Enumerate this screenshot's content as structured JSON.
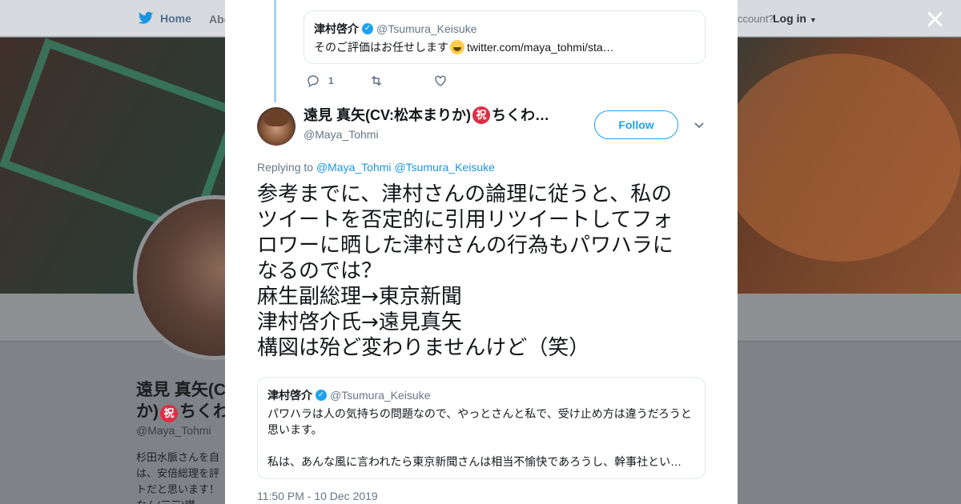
{
  "background": {
    "nav_home": "Home",
    "nav_about": "Abo",
    "account_prompt": "ccount?",
    "login": "Log in",
    "profile_name_line1": "遠見 真矢(C",
    "profile_name_line2": "か)",
    "profile_name_suffix": "ちくわ",
    "profile_name_badge": "祝",
    "profile_handle": "@Maya_Tohmi",
    "bio_lines": [
      "杉田水脈さんを自",
      "は、安倍総理を評",
      "トだと思います！",
      "なん(三三)讃"
    ]
  },
  "previous_tweet": {
    "quoted_name": "津村啓介",
    "quoted_handle": "@Tsumura_Keisuke",
    "quoted_text": "そのご評価はお任せします",
    "quoted_link": "twitter.com/maya_tohmi/sta…",
    "reply_count": "1"
  },
  "tweet": {
    "display_name": "遠見 真矢(CV:松本まりか)",
    "display_badge": "祝",
    "display_suffix": "ちくわ…",
    "handle": "@Maya_Tohmi",
    "follow_label": "Follow",
    "replying_prefix": "Replying to",
    "replying_to_1": "@Maya_Tohmi",
    "replying_to_2": "@Tsumura_Keisuke",
    "text_lines": [
      "参考までに、津村さんの論理に従うと、私の",
      "ツイートを否定的に引用リツイートしてフォ",
      "ロワーに晒した津村さんの行為もパワハラに",
      "なるのでは？",
      "麻生副総理→東京新聞",
      "津村啓介氏→遠見真矢",
      "構図は殆ど変わりませんけど（笑）"
    ],
    "quote": {
      "name": "津村啓介",
      "handle": "@Tsumura_Keisuke",
      "line1": "パワハラは人の気持ちの問題なので、やっとさんと私で、受け止め方は違うだろうと",
      "line2": "思います。",
      "line3": "私は、あんな風に言われたら東京新聞さんは相当不愉快であろうし、幹事社とい…"
    },
    "timestamp": "11:50 PM - 10 Dec 2019"
  },
  "colors": {
    "accent": "#1da1f2",
    "link": "#1b95e0",
    "text": "#14171a",
    "secondary": "#657786"
  }
}
